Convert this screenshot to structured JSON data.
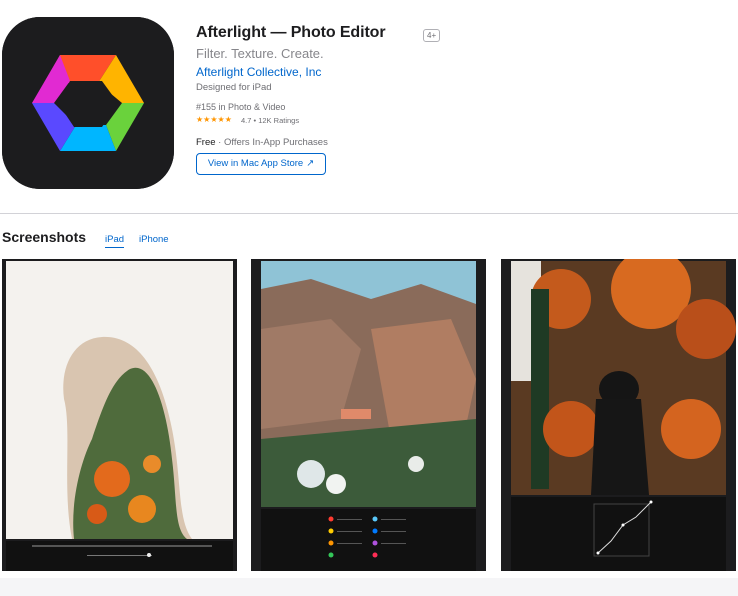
{
  "app": {
    "title": "Afterlight — Photo Editor",
    "age_rating": "4+",
    "subtitle": "Filter. Texture. Create.",
    "developer": "Afterlight Collective, Inc",
    "designed_for": "Designed for iPad",
    "rank": "#155 in Photo & Video",
    "stars": "★★★★★",
    "rating_value": 4.7,
    "rating_text": "4.7 • 12K Ratings",
    "price": "Free",
    "in_app": " · Offers In-App Purchases",
    "store_button": "View in Mac App Store",
    "store_button_icon": "↗"
  },
  "screenshots": {
    "title": "Screenshots",
    "tabs": [
      {
        "label": "iPad",
        "active": true
      },
      {
        "label": "iPhone",
        "active": false
      }
    ],
    "items": [
      {
        "description_icon": "double-exposure-photo"
      },
      {
        "description_icon": "rock-landscape-photo"
      },
      {
        "description_icon": "autumn-forest-photo"
      }
    ]
  },
  "colors": {
    "link": "#0066cc",
    "star": "#ff9500",
    "icon_bg": "#1c1c1e"
  }
}
